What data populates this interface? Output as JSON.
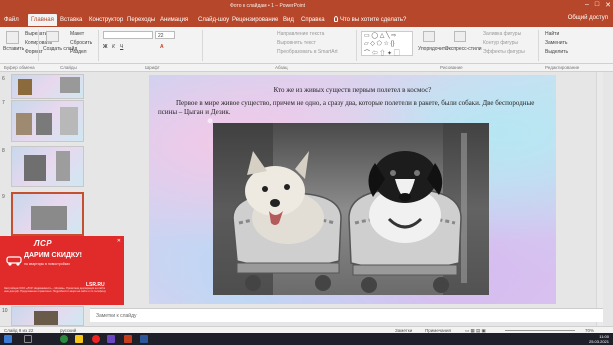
{
  "window": {
    "title": "Фото к слайдам • 1 – PowerPoint",
    "controls": [
      "–",
      "□",
      "✕"
    ]
  },
  "tabs": [
    {
      "label": "Файл"
    },
    {
      "label": "Главная",
      "active": true
    },
    {
      "label": "Вставка"
    },
    {
      "label": "Конструктор"
    },
    {
      "label": "Переходы"
    },
    {
      "label": "Анимация"
    },
    {
      "label": "Слайд-шоу"
    },
    {
      "label": "Рецензирование"
    },
    {
      "label": "Вид"
    },
    {
      "label": "Справка"
    },
    {
      "label": "Что вы хотите сделать?"
    }
  ],
  "account": "Общий доступ",
  "ribbon": {
    "paste": "Вставить",
    "clipboard": {
      "cut": "Вырезать",
      "copy": "Копировать",
      "format": "Формат"
    },
    "new_slide": "Создать слайд",
    "slides": {
      "layout": "Макет",
      "reset": "Сбросить",
      "section": "Раздел"
    },
    "font_size": "22",
    "paragraph": {
      "direction": "Направление текста",
      "align": "Выровнять текст",
      "smartart": "Преобразовать в SmartArt"
    },
    "arrange": "Упорядочить",
    "quick_styles": "Экспресс-стили",
    "shape_fill": "Заливка фигуры",
    "shape_outline": "Контур фигуры",
    "shape_effects": "Эффекты фигуры",
    "editing": {
      "find": "Найти",
      "replace": "Заменить",
      "select": "Выделить"
    },
    "groups": [
      "Буфер обмена",
      "Слайды",
      "Шрифт",
      "Абзац",
      "Рисование",
      "Редактирование"
    ]
  },
  "thumbnails": [
    {
      "number": "6"
    },
    {
      "number": "7"
    },
    {
      "number": "8"
    },
    {
      "number": "9",
      "selected": true
    },
    {
      "number": "10"
    }
  ],
  "ad": {
    "logo": "ЛСР",
    "headline": "ДАРИМ СКИДКУ!",
    "sub": "на квартиры в новостройках",
    "brand": "LSR.RU",
    "fine": "Застройщик ООО «ЛСР. Недвижимость – Москва». Проектная декларация на сайте наш.дом.рф. Предложение ограничено. Подробности акции на сайте и по телефону.",
    "close": "✕"
  },
  "slide": {
    "title": "Кто же из живых существ первым полетел в космос?",
    "body": "Первое в мире живое существо, причем не одно, а сразу два, которые полетели в ракете, были собаки. Две беспородные псины – Цыган и Дезик."
  },
  "notes_placeholder": "Заметки к слайду",
  "status": {
    "slide_info": "Слайд 9 из 22",
    "language": "русский",
    "notes": "Заметки",
    "comments": "Примечания",
    "zoom": "70%"
  },
  "taskbar": {
    "time": "11:00",
    "date": "25.03.2021"
  }
}
